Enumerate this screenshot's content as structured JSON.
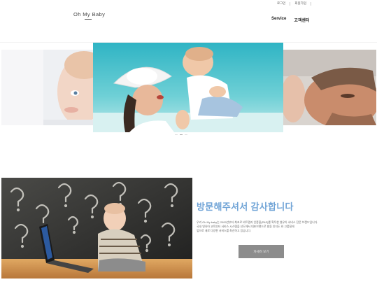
{
  "header": {
    "top_links": [
      "로그인",
      "회원가입"
    ],
    "logo": "Oh My Baby",
    "nav": [
      "Service",
      "고객센터"
    ]
  },
  "slider": {
    "slide_count": 3,
    "active_index": 1
  },
  "welcome": {
    "title": "방문해주셔서 감사합니다",
    "body_lines": [
      "우리 Oh My baby는 2009년부터 최초로 비트맵과 인증을(PAS)를 획득한 영유아 서비스 전문 브랜드입니다.",
      "국내 영유아 교육부터 서비스 시스템을 선도해서 대표브랜드로 발돋 인지도 와 고품질에",
      "앞으로 새로 다양한 서비스를 최선하고 있습니다."
    ],
    "button_label": "자세히 보기"
  }
}
